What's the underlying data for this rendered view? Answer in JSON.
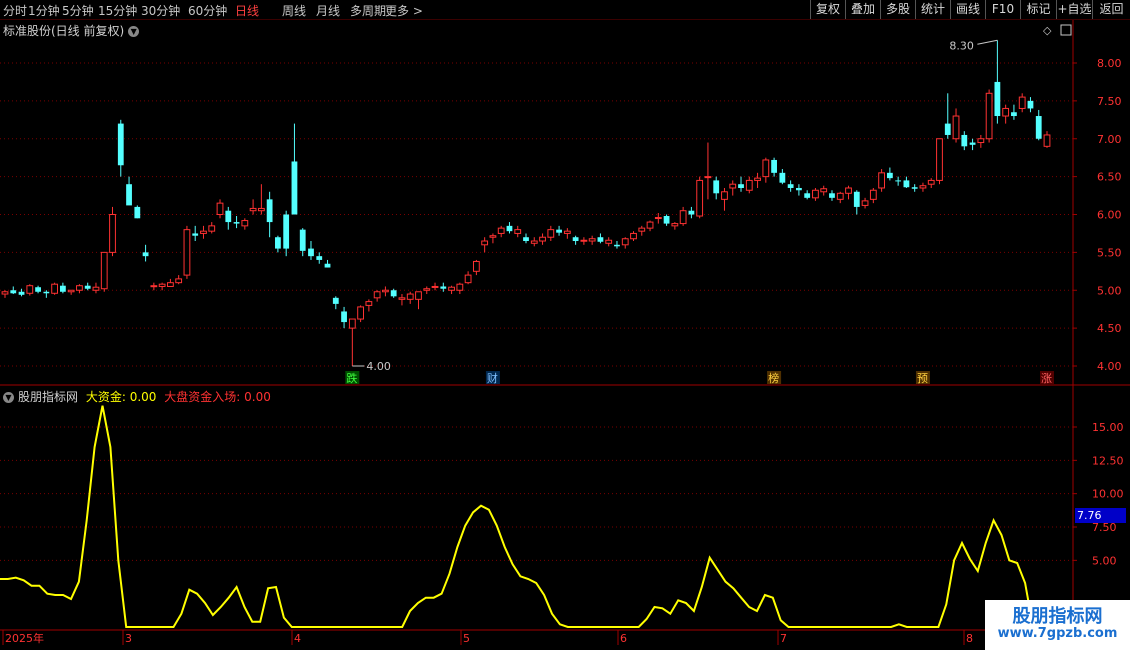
{
  "toolbar": {
    "left": [
      "分时",
      "1分钟",
      "5分钟",
      "15分钟",
      "30分钟",
      "60分钟",
      "日线",
      "周线",
      "月线",
      "多周期",
      "更多 >"
    ],
    "active": "日线",
    "right": [
      "复权",
      "叠加",
      "多股",
      "统计",
      "画线",
      "F10",
      "标记",
      "+自选",
      "返回"
    ]
  },
  "main_title": "标准股份(日线 前复权)",
  "price_axis": [
    "8.00",
    "7.50",
    "7.00",
    "6.50",
    "6.00",
    "5.50",
    "5.00",
    "4.50",
    "4.00"
  ],
  "annotations": {
    "high": "8.30",
    "low": "4.00"
  },
  "event_markers": [
    {
      "label": "跌",
      "color": "#40ff40",
      "bg": "#005000"
    },
    {
      "label": "财",
      "color": "#80c0ff",
      "bg": "#002850"
    },
    {
      "label": "榜",
      "color": "#ffd040",
      "bg": "#503000"
    },
    {
      "label": "预",
      "color": "#ffd040",
      "bg": "#503000"
    },
    {
      "label": "涨",
      "color": "#ff6060",
      "bg": "#500000"
    }
  ],
  "indicator": {
    "name": "股朋指标网",
    "line1_label": "大资金:",
    "line1_value": "0.00",
    "line2_label": "大盘资金入场:",
    "line2_value": "0.00",
    "axis": [
      "15.00",
      "12.50",
      "10.00",
      "7.50",
      "5.00"
    ],
    "current_value": "7.76"
  },
  "date_axis": [
    "2025年",
    "3",
    "4",
    "5",
    "6",
    "7",
    "8"
  ],
  "watermark": {
    "title": "股朋指标网",
    "url": "www.7gpzb.com"
  },
  "colors": {
    "up": "#ff3232",
    "down": "#54ffff",
    "grid": "#7a0000",
    "line": "#ffff00"
  },
  "chart_data": {
    "type": "candlestick",
    "ohlc": [
      [
        4.95,
        5.0,
        4.9,
        4.98
      ],
      [
        5.0,
        5.05,
        4.95,
        4.96
      ],
      [
        4.98,
        5.02,
        4.92,
        4.94
      ],
      [
        4.96,
        5.08,
        4.93,
        5.06
      ],
      [
        5.04,
        5.06,
        4.96,
        4.98
      ],
      [
        4.98,
        5.0,
        4.9,
        4.96
      ],
      [
        4.96,
        5.1,
        4.94,
        5.08
      ],
      [
        5.06,
        5.1,
        4.96,
        4.98
      ],
      [
        4.98,
        5.0,
        4.94,
        5.0
      ],
      [
        5.0,
        5.08,
        4.96,
        5.06
      ],
      [
        5.06,
        5.1,
        5.0,
        5.02
      ],
      [
        5.0,
        5.1,
        4.96,
        5.04
      ],
      [
        5.02,
        5.4,
        4.98,
        5.5
      ],
      [
        5.5,
        6.1,
        5.45,
        6.0
      ],
      [
        7.2,
        7.25,
        6.5,
        6.65
      ],
      [
        6.4,
        6.5,
        6.3,
        6.12
      ],
      [
        6.1,
        6.12,
        5.95,
        5.95
      ],
      [
        5.5,
        5.6,
        5.38,
        5.45
      ],
      [
        5.05,
        5.1,
        5.0,
        5.06
      ],
      [
        5.05,
        5.1,
        5.0,
        5.08
      ],
      [
        5.05,
        5.15,
        5.05,
        5.1
      ],
      [
        5.1,
        5.2,
        5.08,
        5.15
      ],
      [
        5.2,
        5.85,
        5.15,
        5.8
      ],
      [
        5.75,
        5.85,
        5.65,
        5.72
      ],
      [
        5.75,
        5.85,
        5.68,
        5.78
      ],
      [
        5.78,
        5.9,
        5.75,
        5.85
      ],
      [
        6.0,
        6.2,
        5.95,
        6.15
      ],
      [
        6.05,
        6.1,
        5.8,
        5.9
      ],
      [
        5.9,
        5.98,
        5.82,
        5.88
      ],
      [
        5.85,
        5.95,
        5.8,
        5.92
      ],
      [
        6.05,
        6.2,
        6.0,
        6.08
      ],
      [
        6.05,
        6.4,
        6.0,
        6.08
      ],
      [
        6.2,
        6.3,
        5.7,
        5.9
      ],
      [
        5.7,
        5.72,
        5.5,
        5.55
      ],
      [
        6.0,
        6.05,
        5.45,
        5.55
      ],
      [
        6.7,
        7.2,
        6.5,
        6.0
      ],
      [
        5.8,
        5.82,
        5.45,
        5.52
      ],
      [
        5.55,
        5.65,
        5.4,
        5.45
      ],
      [
        5.45,
        5.5,
        5.35,
        5.4
      ],
      [
        5.35,
        5.4,
        5.3,
        5.3
      ],
      [
        4.9,
        4.92,
        4.75,
        4.82
      ],
      [
        4.72,
        4.78,
        4.5,
        4.58
      ],
      [
        4.5,
        4.6,
        4.0,
        4.62
      ],
      [
        4.62,
        4.8,
        4.58,
        4.78
      ],
      [
        4.8,
        4.88,
        4.72,
        4.85
      ],
      [
        4.9,
        5.0,
        4.85,
        4.98
      ],
      [
        4.98,
        5.05,
        4.92,
        5.0
      ],
      [
        5.0,
        5.02,
        4.9,
        4.92
      ],
      [
        4.88,
        4.95,
        4.8,
        4.9
      ],
      [
        4.88,
        4.98,
        4.82,
        4.95
      ],
      [
        4.88,
        4.95,
        4.75,
        4.98
      ],
      [
        5.0,
        5.05,
        4.95,
        5.02
      ],
      [
        5.05,
        5.1,
        5.0,
        5.05
      ],
      [
        5.05,
        5.1,
        4.98,
        5.02
      ],
      [
        5.0,
        5.06,
        4.95,
        5.04
      ],
      [
        5.0,
        5.1,
        4.95,
        5.08
      ],
      [
        5.1,
        5.25,
        5.08,
        5.2
      ],
      [
        5.25,
        5.4,
        5.2,
        5.38
      ],
      [
        5.6,
        5.7,
        5.5,
        5.65
      ],
      [
        5.7,
        5.75,
        5.62,
        5.72
      ],
      [
        5.75,
        5.85,
        5.7,
        5.82
      ],
      [
        5.85,
        5.9,
        5.75,
        5.78
      ],
      [
        5.75,
        5.85,
        5.7,
        5.8
      ],
      [
        5.7,
        5.75,
        5.62,
        5.65
      ],
      [
        5.62,
        5.7,
        5.58,
        5.65
      ],
      [
        5.65,
        5.75,
        5.6,
        5.7
      ],
      [
        5.7,
        5.85,
        5.65,
        5.8
      ],
      [
        5.8,
        5.85,
        5.72,
        5.76
      ],
      [
        5.75,
        5.82,
        5.68,
        5.78
      ],
      [
        5.7,
        5.72,
        5.6,
        5.65
      ],
      [
        5.65,
        5.7,
        5.6,
        5.66
      ],
      [
        5.65,
        5.72,
        5.6,
        5.68
      ],
      [
        5.7,
        5.75,
        5.62,
        5.64
      ],
      [
        5.62,
        5.7,
        5.58,
        5.66
      ],
      [
        5.6,
        5.65,
        5.55,
        5.58
      ],
      [
        5.6,
        5.7,
        5.55,
        5.68
      ],
      [
        5.68,
        5.78,
        5.65,
        5.75
      ],
      [
        5.78,
        5.85,
        5.72,
        5.82
      ],
      [
        5.82,
        5.92,
        5.78,
        5.9
      ],
      [
        5.95,
        6.02,
        5.88,
        5.96
      ],
      [
        5.98,
        6.0,
        5.85,
        5.88
      ],
      [
        5.85,
        5.9,
        5.8,
        5.88
      ],
      [
        5.88,
        6.1,
        5.85,
        6.05
      ],
      [
        6.05,
        6.1,
        5.95,
        6.0
      ],
      [
        5.98,
        6.5,
        5.95,
        6.45
      ],
      [
        6.5,
        6.95,
        6.2,
        6.5
      ],
      [
        6.45,
        6.5,
        6.2,
        6.28
      ],
      [
        6.2,
        6.35,
        6.05,
        6.3
      ],
      [
        6.35,
        6.45,
        6.25,
        6.4
      ],
      [
        6.4,
        6.5,
        6.3,
        6.35
      ],
      [
        6.32,
        6.5,
        6.28,
        6.45
      ],
      [
        6.45,
        6.55,
        6.35,
        6.48
      ],
      [
        6.5,
        6.75,
        6.42,
        6.72
      ],
      [
        6.72,
        6.75,
        6.5,
        6.55
      ],
      [
        6.55,
        6.6,
        6.4,
        6.42
      ],
      [
        6.4,
        6.45,
        6.3,
        6.35
      ],
      [
        6.35,
        6.4,
        6.25,
        6.32
      ],
      [
        6.28,
        6.32,
        6.2,
        6.22
      ],
      [
        6.22,
        6.35,
        6.18,
        6.32
      ],
      [
        6.3,
        6.38,
        6.25,
        6.34
      ],
      [
        6.28,
        6.32,
        6.18,
        6.22
      ],
      [
        6.2,
        6.3,
        6.15,
        6.28
      ],
      [
        6.28,
        6.38,
        6.2,
        6.35
      ],
      [
        6.3,
        6.32,
        6.0,
        6.1
      ],
      [
        6.12,
        6.22,
        6.08,
        6.18
      ],
      [
        6.2,
        6.35,
        6.15,
        6.32
      ],
      [
        6.35,
        6.6,
        6.3,
        6.55
      ],
      [
        6.55,
        6.62,
        6.45,
        6.48
      ],
      [
        6.45,
        6.5,
        6.38,
        6.44
      ],
      [
        6.45,
        6.5,
        6.35,
        6.36
      ],
      [
        6.36,
        6.4,
        6.3,
        6.34
      ],
      [
        6.35,
        6.42,
        6.3,
        6.38
      ],
      [
        6.4,
        6.48,
        6.35,
        6.45
      ],
      [
        6.45,
        7.0,
        6.4,
        7.0
      ],
      [
        7.2,
        7.6,
        7.0,
        7.05
      ],
      [
        7.0,
        7.4,
        6.95,
        7.3
      ],
      [
        7.05,
        7.1,
        6.85,
        6.9
      ],
      [
        6.95,
        7.0,
        6.85,
        6.92
      ],
      [
        6.95,
        7.05,
        6.88,
        7.0
      ],
      [
        7.0,
        7.65,
        6.95,
        7.6
      ],
      [
        7.75,
        8.3,
        7.2,
        7.3
      ],
      [
        7.3,
        7.45,
        7.2,
        7.4
      ],
      [
        7.35,
        7.45,
        7.25,
        7.3
      ],
      [
        7.4,
        7.6,
        7.35,
        7.55
      ],
      [
        7.5,
        7.55,
        7.35,
        7.4
      ],
      [
        7.3,
        7.38,
        6.98,
        7.0
      ],
      [
        6.9,
        7.1,
        6.88,
        7.05
      ]
    ],
    "indicator_values": [
      3.6,
      3.6,
      3.7,
      3.5,
      3.1,
      3.1,
      2.5,
      2.4,
      2.4,
      2.1,
      3.4,
      8.0,
      13.5,
      16.6,
      13.5,
      5.0,
      0.0,
      0.0,
      0.0,
      0.0,
      0.0,
      0.0,
      0.0,
      1.0,
      2.8,
      2.5,
      1.8,
      0.9,
      1.5,
      2.2,
      3.0,
      1.5,
      0.4,
      0.4,
      2.9,
      3.0,
      0.7,
      0.0,
      0.0,
      0.0,
      0.0,
      0.0,
      0.0,
      0.0,
      0.0,
      0.0,
      0.0,
      0.0,
      0.0,
      0.0,
      0.0,
      0.0,
      1.2,
      1.8,
      2.2,
      2.2,
      2.5,
      4.0,
      6.0,
      7.6,
      8.6,
      9.1,
      8.8,
      7.6,
      6.0,
      4.7,
      3.8,
      3.6,
      3.3,
      2.4,
      1.0,
      0.2,
      0.0,
      0.0,
      0.0,
      0.0,
      0.0,
      0.0,
      0.0,
      0.0,
      0.0,
      0.0,
      0.6,
      1.5,
      1.4,
      1.0,
      2.0,
      1.8,
      1.2,
      3.0,
      5.2,
      4.3,
      3.4,
      2.9,
      2.2,
      1.5,
      1.2,
      2.4,
      2.2,
      0.5,
      0.0,
      0.0,
      0.0,
      0.0,
      0.0,
      0.0,
      0.0,
      0.0,
      0.0,
      0.0,
      0.0,
      0.0,
      0.0,
      0.0,
      0.2,
      0.0,
      0.0,
      0.0,
      0.0,
      0.0,
      1.7,
      5.0,
      6.3,
      5.1,
      4.2,
      6.3,
      8.0,
      6.9,
      5.0,
      4.8,
      3.3,
      0.0
    ],
    "ylim_price": [
      3.8,
      8.4
    ],
    "ylim_indicator": [
      0,
      18
    ]
  }
}
